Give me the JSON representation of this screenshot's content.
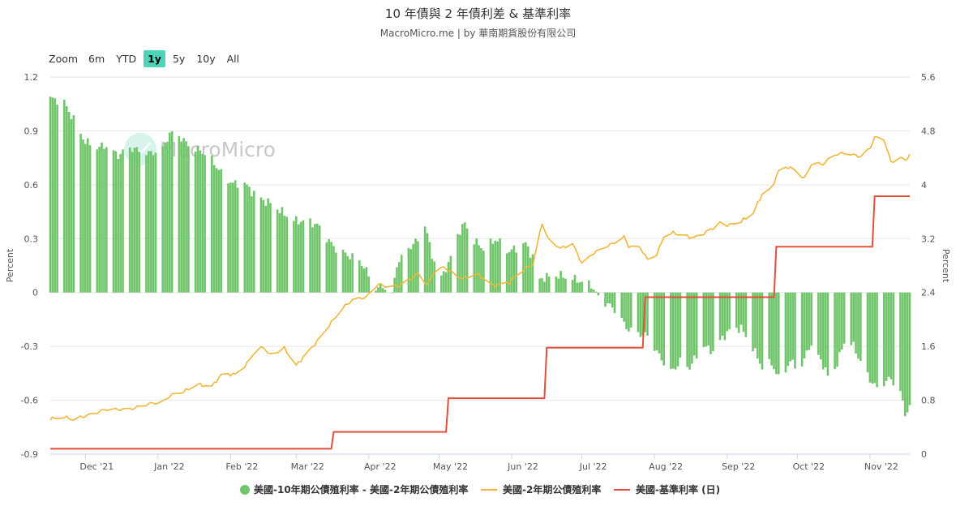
{
  "title": "10 年債與 2 年債利差 & 基準利率",
  "subtitle": "MacroMicro.me | by 華南期貨股份有限公司",
  "range_selector": {
    "zoom_label": "Zoom",
    "buttons": [
      "6m",
      "YTD",
      "1y",
      "5y",
      "10y",
      "All"
    ],
    "active": "1y"
  },
  "watermark": "MacroMicro",
  "colors": {
    "spread": "#70c56b",
    "two_year": "#f0b63a",
    "fed_rate": "#e0503a",
    "grid": "#e6e6e6",
    "active_button": "#4dd5b9"
  },
  "chart_data": {
    "type": "bar",
    "x_axis": {
      "type": "datetime",
      "range": [
        "2021-11-16",
        "2022-11-18"
      ],
      "tick_labels": [
        "Dec '21",
        "Jan '22",
        "Feb '22",
        "Mar '22",
        "Apr '22",
        "May '22",
        "Jun '22",
        "Jul '22",
        "Aug '22",
        "Sep '22",
        "Oct '22",
        "Nov '22"
      ],
      "tick_dates": [
        "2021-12-01",
        "2022-01-01",
        "2022-02-01",
        "2022-03-01",
        "2022-04-01",
        "2022-05-01",
        "2022-06-01",
        "2022-07-01",
        "2022-08-01",
        "2022-09-01",
        "2022-10-01",
        "2022-11-01"
      ]
    },
    "y_axis_left": {
      "title": "Percent",
      "range": [
        -0.9,
        1.2
      ],
      "tick_labels": [
        "1.2",
        "0.9",
        "0.6",
        "0.3",
        "0",
        "-0.3",
        "-0.6",
        "-0.9"
      ],
      "ticks": [
        1.2,
        0.9,
        0.6,
        0.3,
        0,
        -0.3,
        -0.6,
        -0.9
      ]
    },
    "y_axis_right": {
      "title": "Percent",
      "range": [
        0,
        5.6
      ],
      "tick_labels": [
        "5.6",
        "4.8",
        "4",
        "3.2",
        "2.4",
        "1.6",
        "0.8",
        "0"
      ],
      "ticks": [
        5.6,
        4.8,
        4,
        3.2,
        2.4,
        1.6,
        0.8,
        0
      ]
    },
    "grid": true,
    "legend_position": "bottom-center",
    "series": [
      {
        "name": "美國-10年期公債殖利率 - 美國-2年期公債殖利率",
        "type": "bar",
        "axis": "left",
        "color": "#70c56b",
        "keypoints": [
          [
            "2021-11-16",
            1.08
          ],
          [
            "2021-11-22",
            1.05
          ],
          [
            "2021-11-26",
            0.97
          ],
          [
            "2021-12-01",
            0.84
          ],
          [
            "2021-12-06",
            0.8
          ],
          [
            "2021-12-10",
            0.82
          ],
          [
            "2021-12-15",
            0.77
          ],
          [
            "2021-12-20",
            0.8
          ],
          [
            "2021-12-23",
            0.79
          ],
          [
            "2021-12-28",
            0.78
          ],
          [
            "2022-01-03",
            0.8
          ],
          [
            "2022-01-06",
            0.88
          ],
          [
            "2022-01-10",
            0.87
          ],
          [
            "2022-01-14",
            0.83
          ],
          [
            "2022-01-19",
            0.79
          ],
          [
            "2022-01-24",
            0.73
          ],
          [
            "2022-01-28",
            0.67
          ],
          [
            "2022-02-02",
            0.61
          ],
          [
            "2022-02-07",
            0.6
          ],
          [
            "2022-02-10",
            0.56
          ],
          [
            "2022-02-15",
            0.52
          ],
          [
            "2022-02-18",
            0.5
          ],
          [
            "2022-02-24",
            0.43
          ],
          [
            "2022-03-01",
            0.4
          ],
          [
            "2022-03-05",
            0.41
          ],
          [
            "2022-03-10",
            0.37
          ],
          [
            "2022-03-14",
            0.3
          ],
          [
            "2022-03-17",
            0.26
          ],
          [
            "2022-03-21",
            0.23
          ],
          [
            "2022-03-24",
            0.2
          ],
          [
            "2022-03-28",
            0.17
          ],
          [
            "2022-03-31",
            0.12
          ],
          [
            "2022-04-04",
            0.03
          ],
          [
            "2022-04-07",
            0.04
          ],
          [
            "2022-04-11",
            -0.02
          ],
          [
            "2022-04-13",
            0.15
          ],
          [
            "2022-04-18",
            0.25
          ],
          [
            "2022-04-22",
            0.3
          ],
          [
            "2022-04-25",
            0.38
          ],
          [
            "2022-04-28",
            0.2
          ],
          [
            "2022-05-02",
            0.08
          ],
          [
            "2022-05-06",
            0.2
          ],
          [
            "2022-05-09",
            0.33
          ],
          [
            "2022-05-12",
            0.38
          ],
          [
            "2022-05-16",
            0.28
          ],
          [
            "2022-05-20",
            0.25
          ],
          [
            "2022-05-25",
            0.3
          ],
          [
            "2022-05-31",
            0.22
          ],
          [
            "2022-06-03",
            0.25
          ],
          [
            "2022-06-07",
            0.28
          ],
          [
            "2022-06-10",
            0.2
          ],
          [
            "2022-06-13",
            0.07
          ],
          [
            "2022-06-16",
            0.08
          ],
          [
            "2022-06-22",
            0.1
          ],
          [
            "2022-06-27",
            0.08
          ],
          [
            "2022-07-01",
            0.05
          ],
          [
            "2022-07-05",
            0.04
          ],
          [
            "2022-07-08",
            -0.02
          ],
          [
            "2022-07-12",
            -0.06
          ],
          [
            "2022-07-15",
            -0.1
          ],
          [
            "2022-07-20",
            -0.2
          ],
          [
            "2022-07-25",
            -0.22
          ],
          [
            "2022-07-29",
            -0.24
          ],
          [
            "2022-08-03",
            -0.36
          ],
          [
            "2022-08-08",
            -0.44
          ],
          [
            "2022-08-12",
            -0.38
          ],
          [
            "2022-08-16",
            -0.42
          ],
          [
            "2022-08-22",
            -0.3
          ],
          [
            "2022-08-26",
            -0.32
          ],
          [
            "2022-08-30",
            -0.25
          ],
          [
            "2022-09-02",
            -0.22
          ],
          [
            "2022-09-07",
            -0.2
          ],
          [
            "2022-09-12",
            -0.3
          ],
          [
            "2022-09-16",
            -0.42
          ],
          [
            "2022-09-20",
            -0.4
          ],
          [
            "2022-09-23",
            -0.48
          ],
          [
            "2022-09-28",
            -0.38
          ],
          [
            "2022-10-03",
            -0.42
          ],
          [
            "2022-10-06",
            -0.3
          ],
          [
            "2022-10-11",
            -0.37
          ],
          [
            "2022-10-14",
            -0.46
          ],
          [
            "2022-10-18",
            -0.4
          ],
          [
            "2022-10-21",
            -0.28
          ],
          [
            "2022-10-25",
            -0.3
          ],
          [
            "2022-10-28",
            -0.38
          ],
          [
            "2022-11-01",
            -0.48
          ],
          [
            "2022-11-04",
            -0.54
          ],
          [
            "2022-11-08",
            -0.5
          ],
          [
            "2022-11-10",
            -0.48
          ],
          [
            "2022-11-14",
            -0.55
          ],
          [
            "2022-11-16",
            -0.67
          ],
          [
            "2022-11-18",
            -0.64
          ]
        ]
      },
      {
        "name": "美國-2年期公債殖利率",
        "type": "line",
        "axis": "right",
        "color": "#f0b63a",
        "keypoints": [
          [
            "2021-11-16",
            0.53
          ],
          [
            "2021-11-22",
            0.55
          ],
          [
            "2021-11-26",
            0.5
          ],
          [
            "2021-12-01",
            0.57
          ],
          [
            "2021-12-06",
            0.63
          ],
          [
            "2021-12-10",
            0.66
          ],
          [
            "2021-12-15",
            0.66
          ],
          [
            "2021-12-21",
            0.68
          ],
          [
            "2021-12-28",
            0.74
          ],
          [
            "2022-01-03",
            0.78
          ],
          [
            "2022-01-06",
            0.87
          ],
          [
            "2022-01-12",
            0.92
          ],
          [
            "2022-01-18",
            1.04
          ],
          [
            "2022-01-24",
            1.01
          ],
          [
            "2022-01-28",
            1.17
          ],
          [
            "2022-02-03",
            1.19
          ],
          [
            "2022-02-08",
            1.35
          ],
          [
            "2022-02-11",
            1.5
          ],
          [
            "2022-02-15",
            1.58
          ],
          [
            "2022-02-18",
            1.47
          ],
          [
            "2022-02-24",
            1.58
          ],
          [
            "2022-03-01",
            1.31
          ],
          [
            "2022-03-08",
            1.6
          ],
          [
            "2022-03-14",
            1.86
          ],
          [
            "2022-03-21",
            2.17
          ],
          [
            "2022-03-25",
            2.3
          ],
          [
            "2022-03-31",
            2.33
          ],
          [
            "2022-04-05",
            2.52
          ],
          [
            "2022-04-08",
            2.5
          ],
          [
            "2022-04-14",
            2.5
          ],
          [
            "2022-04-19",
            2.6
          ],
          [
            "2022-04-22",
            2.68
          ],
          [
            "2022-04-26",
            2.52
          ],
          [
            "2022-04-29",
            2.72
          ],
          [
            "2022-05-03",
            2.77
          ],
          [
            "2022-05-09",
            2.63
          ],
          [
            "2022-05-12",
            2.62
          ],
          [
            "2022-05-17",
            2.68
          ],
          [
            "2022-05-20",
            2.6
          ],
          [
            "2022-05-24",
            2.5
          ],
          [
            "2022-05-31",
            2.56
          ],
          [
            "2022-06-06",
            2.73
          ],
          [
            "2022-06-10",
            2.82
          ],
          [
            "2022-06-14",
            3.43
          ],
          [
            "2022-06-17",
            3.17
          ],
          [
            "2022-06-22",
            3.05
          ],
          [
            "2022-06-27",
            3.13
          ],
          [
            "2022-07-01",
            2.84
          ],
          [
            "2022-07-06",
            2.98
          ],
          [
            "2022-07-11",
            3.07
          ],
          [
            "2022-07-14",
            3.13
          ],
          [
            "2022-07-19",
            3.23
          ],
          [
            "2022-07-21",
            3.08
          ],
          [
            "2022-07-26",
            3.06
          ],
          [
            "2022-07-29",
            2.89
          ],
          [
            "2022-08-02",
            2.97
          ],
          [
            "2022-08-05",
            3.23
          ],
          [
            "2022-08-09",
            3.28
          ],
          [
            "2022-08-12",
            3.25
          ],
          [
            "2022-08-18",
            3.22
          ],
          [
            "2022-08-24",
            3.31
          ],
          [
            "2022-08-29",
            3.43
          ],
          [
            "2022-09-02",
            3.4
          ],
          [
            "2022-09-07",
            3.45
          ],
          [
            "2022-09-12",
            3.57
          ],
          [
            "2022-09-16",
            3.87
          ],
          [
            "2022-09-20",
            3.96
          ],
          [
            "2022-09-23",
            4.2
          ],
          [
            "2022-09-27",
            4.26
          ],
          [
            "2022-09-30",
            4.22
          ],
          [
            "2022-10-04",
            4.1
          ],
          [
            "2022-10-07",
            4.31
          ],
          [
            "2022-10-12",
            4.3
          ],
          [
            "2022-10-17",
            4.45
          ],
          [
            "2022-10-21",
            4.48
          ],
          [
            "2022-10-25",
            4.44
          ],
          [
            "2022-10-28",
            4.41
          ],
          [
            "2022-11-01",
            4.54
          ],
          [
            "2022-11-03",
            4.71
          ],
          [
            "2022-11-07",
            4.68
          ],
          [
            "2022-11-10",
            4.33
          ],
          [
            "2022-11-14",
            4.4
          ],
          [
            "2022-11-16",
            4.36
          ],
          [
            "2022-11-18",
            4.45
          ]
        ]
      },
      {
        "name": "美國-基準利率 (日)",
        "type": "line",
        "axis": "right",
        "color": "#e0503a",
        "points": [
          [
            "2021-11-16",
            0.08
          ],
          [
            "2022-03-16",
            0.08
          ],
          [
            "2022-03-17",
            0.33
          ],
          [
            "2022-05-04",
            0.33
          ],
          [
            "2022-05-05",
            0.83
          ],
          [
            "2022-06-15",
            0.83
          ],
          [
            "2022-06-16",
            1.58
          ],
          [
            "2022-07-27",
            1.58
          ],
          [
            "2022-07-28",
            2.33
          ],
          [
            "2022-09-21",
            2.33
          ],
          [
            "2022-09-22",
            3.08
          ],
          [
            "2022-11-02",
            3.08
          ],
          [
            "2022-11-03",
            3.83
          ],
          [
            "2022-11-18",
            3.83
          ]
        ]
      }
    ]
  }
}
